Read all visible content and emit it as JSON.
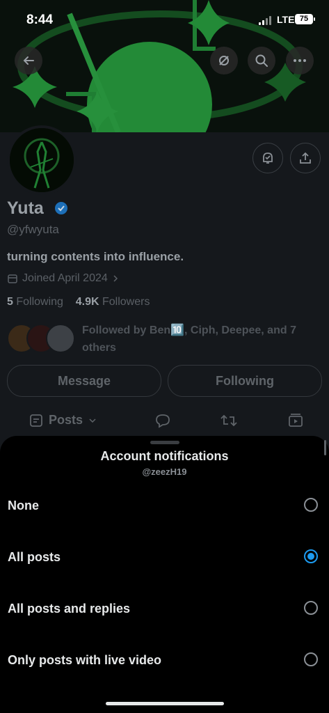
{
  "status_bar": {
    "time": "8:44",
    "network": "LTE",
    "battery": "75"
  },
  "profile": {
    "name": "Yuta",
    "handle": "@yfwyuta",
    "bio": "turning contents into influence.",
    "joined": "Joined April 2024",
    "following_count": "5",
    "following_label": "Following",
    "followers_count": "4.9K",
    "followers_label": "Followers",
    "followed_by": "Followed by Ben🔟, Ciph, Deepee, and 7 others",
    "message_button": "Message",
    "following_button": "Following",
    "tab_posts": "Posts"
  },
  "sheet": {
    "title": "Account notifications",
    "subtitle": "@zeezH19",
    "options": [
      {
        "label": "None",
        "selected": false
      },
      {
        "label": "All posts",
        "selected": true
      },
      {
        "label": "All posts and replies",
        "selected": false
      },
      {
        "label": "Only posts with live video",
        "selected": false
      }
    ]
  },
  "colors": {
    "accent": "#1d9bf0",
    "banner_green": "#2fb84a",
    "sheet_bg": "#000000"
  },
  "icons": [
    "back-arrow-icon",
    "grok-icon",
    "search-icon",
    "more-icon",
    "bell-check-icon",
    "share-icon",
    "verified-badge-icon",
    "calendar-icon",
    "chevron-right-icon",
    "posts-icon",
    "chevron-down-icon",
    "reply-icon",
    "repost-icon",
    "media-icon"
  ]
}
